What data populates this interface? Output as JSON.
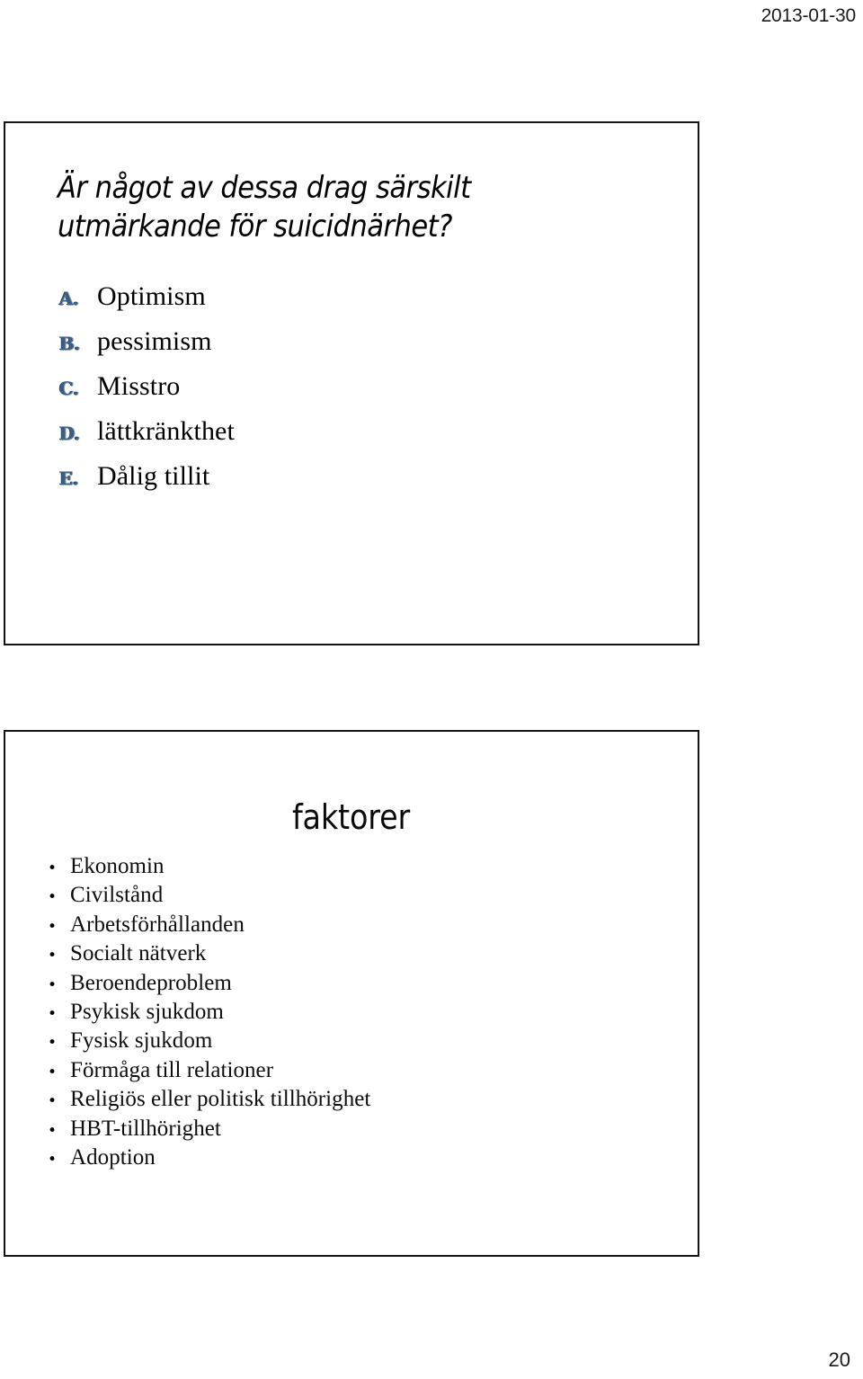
{
  "page": {
    "date": "2013-01-30",
    "page_number": "20",
    "background_color": "#ffffff",
    "text_color": "#000000",
    "marker_accent_color": "#3c5e84",
    "slide_border_color": "#141414"
  },
  "slides": [
    {
      "id": "slide-1",
      "title": "Är något av dessa drag särskilt utmärkande för suicidnärhet?",
      "title_style": "italic",
      "list_type": "alpha",
      "items": [
        {
          "marker": "A.",
          "label": "Optimism"
        },
        {
          "marker": "B.",
          "label": "pessimism"
        },
        {
          "marker": "C.",
          "label": "Misstro"
        },
        {
          "marker": "D.",
          "label": "lättkränkthet"
        },
        {
          "marker": "E.",
          "label": "Dålig tillit"
        }
      ]
    },
    {
      "id": "slide-2",
      "title": "faktorer",
      "title_style": "plain-centered",
      "list_type": "bullet",
      "bullet_glyph": "•",
      "items": [
        {
          "label": "Ekonomin"
        },
        {
          "label": "Civilstånd"
        },
        {
          "label": "Arbetsförhållanden"
        },
        {
          "label": "Socialt nätverk"
        },
        {
          "label": "Beroendeproblem"
        },
        {
          "label": "Psykisk sjukdom"
        },
        {
          "label": "Fysisk sjukdom"
        },
        {
          "label": "Förmåga till relationer"
        },
        {
          "label": "Religiös eller politisk tillhörighet"
        },
        {
          "label": "HBT-tillhörighet"
        },
        {
          "label": "Adoption"
        }
      ]
    }
  ]
}
